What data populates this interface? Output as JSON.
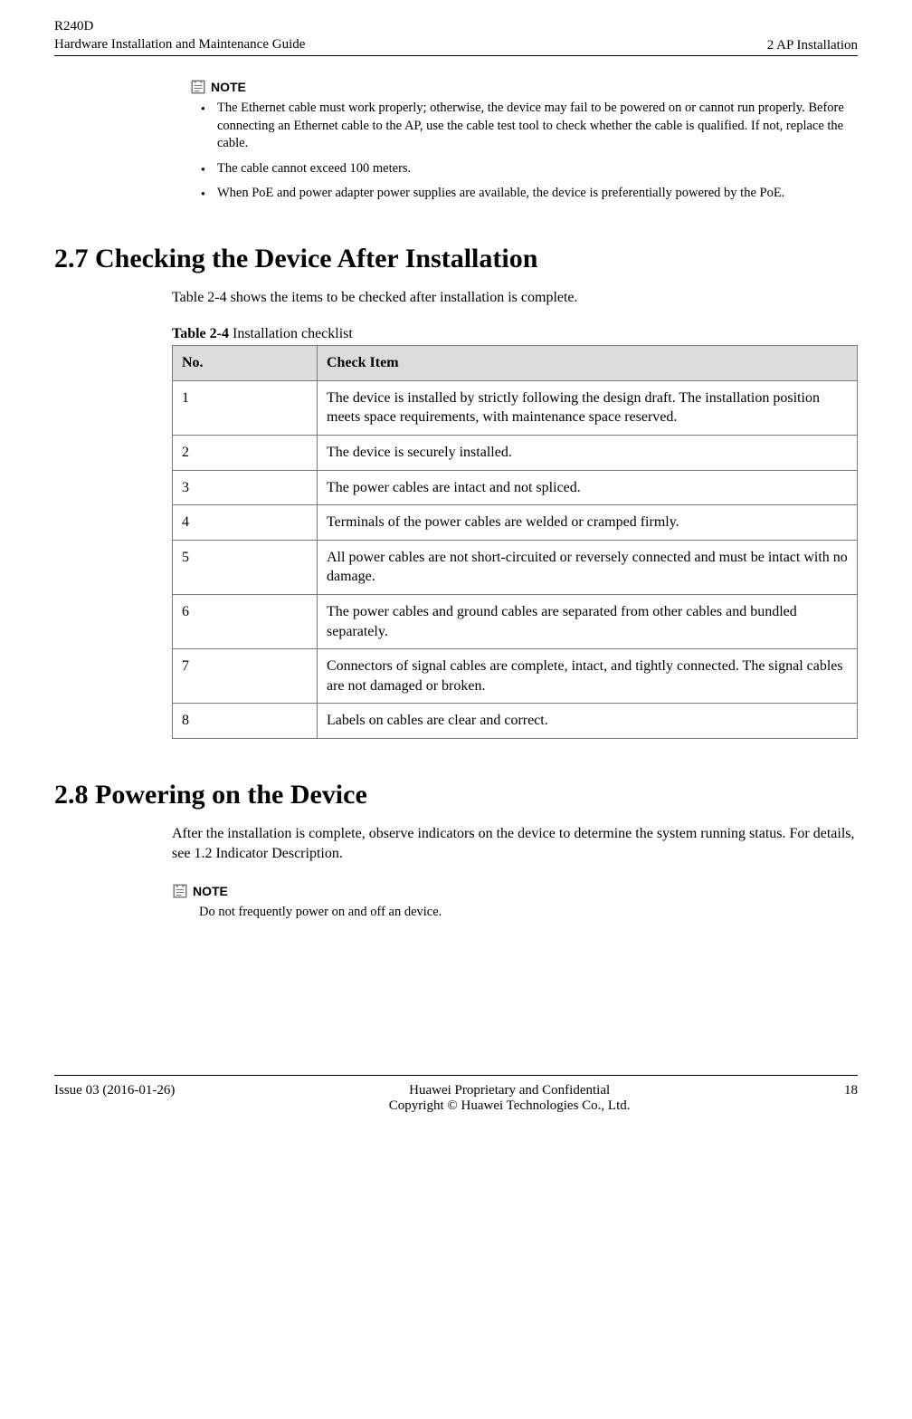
{
  "header": {
    "model": "R240D",
    "title": "Hardware Installation and Maintenance Guide",
    "chapter": "2 AP Installation"
  },
  "note1": {
    "label": "NOTE",
    "items": [
      "The Ethernet cable must work properly; otherwise, the device may fail to be powered on or cannot run properly. Before connecting an Ethernet cable to the AP, use the cable test tool to check whether the cable is qualified. If not, replace the cable.",
      "The cable cannot exceed 100 meters.",
      "When PoE and power adapter power supplies are available, the device is preferentially powered by the PoE."
    ]
  },
  "section27": {
    "heading": "2.7 Checking the Device After Installation",
    "intro_prefix": "Table 2-4",
    "intro_suffix": " shows the items to be checked after installation is complete.",
    "table_caption_bold": "Table 2-4",
    "table_caption_rest": " Installation checklist",
    "columns": [
      "No.",
      "Check Item"
    ],
    "rows": [
      {
        "no": "1",
        "item": "The device is installed by strictly following the design draft. The installation position meets space requirements, with maintenance space reserved."
      },
      {
        "no": "2",
        "item": "The device is securely installed."
      },
      {
        "no": "3",
        "item": "The power cables are intact and not spliced."
      },
      {
        "no": "4",
        "item": "Terminals of the power cables are welded or cramped firmly."
      },
      {
        "no": "5",
        "item": "All power cables are not short-circuited or reversely connected and must be intact with no damage."
      },
      {
        "no": "6",
        "item": "The power cables and ground cables are separated from other cables and bundled separately."
      },
      {
        "no": "7",
        "item": "Connectors of signal cables are complete, intact, and tightly connected. The signal cables are not damaged or broken."
      },
      {
        "no": "8",
        "item": "Labels on cables are clear and correct."
      }
    ]
  },
  "section28": {
    "heading": "2.8 Powering on the Device",
    "body_prefix": "After the installation is complete, observe indicators on the device to determine the system running status. For details, see ",
    "body_link": "1.2 Indicator Description",
    "body_suffix": "."
  },
  "note2": {
    "label": "NOTE",
    "text": "Do not frequently power on and off an device."
  },
  "footer": {
    "issue": "Issue 03 (2016-01-26)",
    "line1": "Huawei Proprietary and Confidential",
    "line2": "Copyright © Huawei Technologies Co., Ltd.",
    "page": "18"
  }
}
